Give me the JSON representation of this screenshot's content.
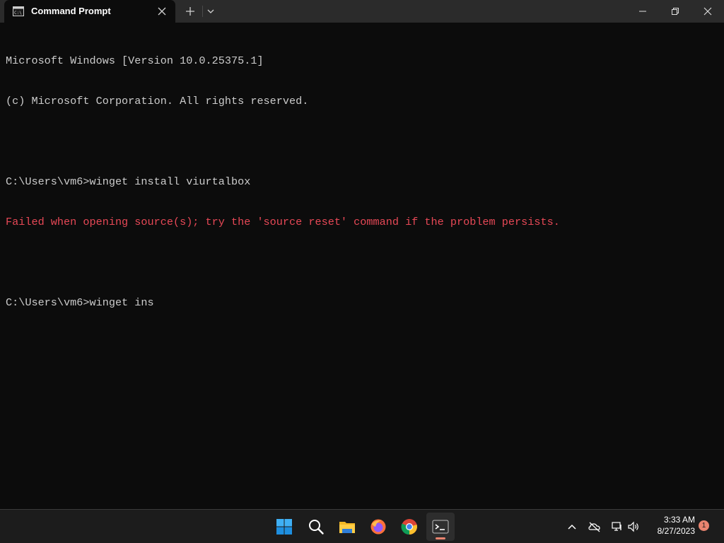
{
  "window": {
    "tab_title": "Command Prompt",
    "icons": [
      "cmd-icon",
      "close-tab-icon",
      "plus-icon",
      "chevron-down-icon",
      "minimize-icon",
      "maximize-icon",
      "close-icon"
    ]
  },
  "terminal": {
    "lines": [
      {
        "text": "Microsoft Windows [Version 10.0.25375.1]",
        "type": "output"
      },
      {
        "text": "(c) Microsoft Corporation. All rights reserved.",
        "type": "output"
      },
      {
        "text": "",
        "type": "blank"
      },
      {
        "text": "C:\\Users\\vm6>winget install viurtalbox",
        "type": "command"
      },
      {
        "text": "Failed when opening source(s); try the 'source reset' command if the problem persists.",
        "type": "error"
      },
      {
        "text": "",
        "type": "blank"
      },
      {
        "text": "C:\\Users\\vm6>winget ins",
        "type": "command"
      }
    ],
    "text_color": "#cccccc",
    "error_color": "#e74856",
    "background": "#0c0c0c"
  },
  "taskbar": {
    "apps": [
      "windows-start-icon",
      "search-icon",
      "file-explorer-icon",
      "firefox-icon",
      "chrome-icon",
      "terminal-icon"
    ],
    "active_app": "terminal-icon",
    "tray_icons": [
      "chevron-up-icon",
      "onedrive-icon",
      "network-icon",
      "volume-icon"
    ],
    "time": "3:33 AM",
    "date": "8/27/2023",
    "notification_count": "1",
    "accent": "#e9846f"
  }
}
